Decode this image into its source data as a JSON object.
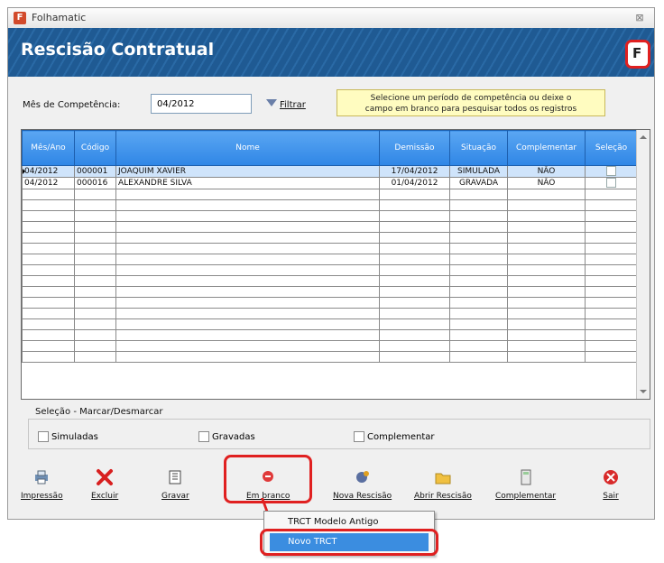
{
  "window": {
    "title": "Folhamatic",
    "close_label": "⊠"
  },
  "header": {
    "title": "Rescisão Contratual",
    "logo_letter": "F"
  },
  "filter": {
    "label": "Mês de Competência:",
    "value": "04/2012",
    "button_label": "Filtrar",
    "hint_line1": "Selecione um período de competência ou deixe o",
    "hint_line2": "campo em branco para pesquisar todos os registros"
  },
  "grid": {
    "columns": [
      "Mês/Ano",
      "Código",
      "Nome",
      "Demissão",
      "Situação",
      "Complementar",
      "Seleção"
    ],
    "rows": [
      [
        "04/2012",
        "000001",
        "JOAQUIM XAVIER",
        "17/04/2012",
        "SIMULADA",
        "NÃO",
        ""
      ],
      [
        "04/2012",
        "000016",
        "ALEXANDRE SILVA",
        "01/04/2012",
        "GRAVADA",
        "NÃO",
        ""
      ]
    ]
  },
  "selection": {
    "title": "Seleção - Marcar/Desmarcar",
    "simuladas": "Simuladas",
    "gravadas": "Gravadas",
    "complementar": "Complementar"
  },
  "toolbar": {
    "impressao": "Impressão",
    "excluir": "Excluir",
    "gravar": "Gravar",
    "em_branco": "Em branco",
    "nova_rescisao": "Nova Rescisão",
    "abrir_rescisao": "Abrir Rescisão",
    "complementar": "Complementar",
    "sair": "Sair"
  },
  "dropdown": {
    "item1": "TRCT Modelo Antigo",
    "item2": "Novo TRCT"
  },
  "colors": {
    "header_blue": "#1f5a93",
    "grid_header": "#2f86e6",
    "highlight_red": "#e02020",
    "hint_yellow": "#fffcc0",
    "menu_selected": "#3b8de0"
  }
}
